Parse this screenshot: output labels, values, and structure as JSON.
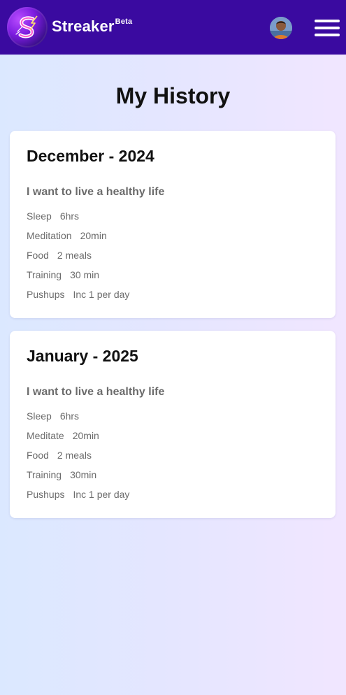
{
  "header": {
    "brand": "Streaker",
    "beta": "Beta",
    "logo_icon": "lightning-s-logo",
    "avatar_icon": "user-avatar",
    "menu_icon": "hamburger-menu-icon",
    "bar_color": "#3a0aa0"
  },
  "page": {
    "title": "My History"
  },
  "history": [
    {
      "title": "December - 2024",
      "goal": "I want to live a healthy life",
      "rows": [
        {
          "label": "Sleep",
          "value": "6hrs"
        },
        {
          "label": "Meditation",
          "value": "20min"
        },
        {
          "label": "Food",
          "value": "2 meals"
        },
        {
          "label": "Training",
          "value": "30 min"
        },
        {
          "label": "Pushups",
          "value": "Inc 1 per day"
        }
      ]
    },
    {
      "title": "January - 2025",
      "goal": "I want to live a healthy life",
      "rows": [
        {
          "label": "Sleep",
          "value": "6hrs"
        },
        {
          "label": "Meditate",
          "value": "20min"
        },
        {
          "label": "Food",
          "value": "2 meals"
        },
        {
          "label": "Training",
          "value": "30min"
        },
        {
          "label": "Pushups",
          "value": "Inc 1 per day"
        }
      ]
    }
  ]
}
